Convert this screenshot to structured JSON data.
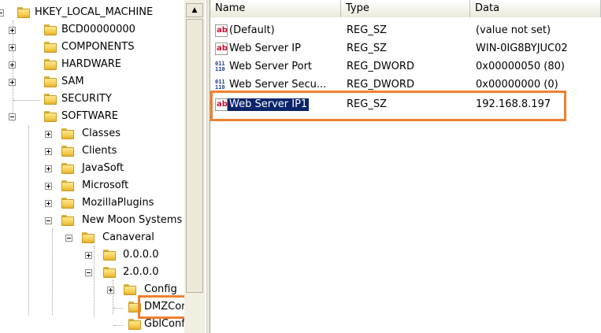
{
  "tree": {
    "root": "HKEY_LOCAL_MACHINE",
    "items": [
      {
        "label": "BCD00000000",
        "expandable": true
      },
      {
        "label": "COMPONENTS",
        "expandable": true
      },
      {
        "label": "HARDWARE",
        "expandable": true
      },
      {
        "label": "SAM",
        "expandable": true
      },
      {
        "label": "SECURITY",
        "expandable": false
      },
      {
        "label": "SOFTWARE",
        "expanded": true
      },
      {
        "label": "Classes"
      },
      {
        "label": "Clients"
      },
      {
        "label": "JavaSoft"
      },
      {
        "label": "Microsoft"
      },
      {
        "label": "MozillaPlugins"
      },
      {
        "label": "New Moon Systems",
        "expanded": true
      },
      {
        "label": "Canaveral",
        "expanded": true
      },
      {
        "label": "0.0.0.0"
      },
      {
        "label": "2.0.0.0",
        "expanded": true
      },
      {
        "label": "Config"
      },
      {
        "label": "DMZCon",
        "highlighted": true
      },
      {
        "label": "GblConfi"
      }
    ]
  },
  "list": {
    "columns": [
      "Name",
      "Type",
      "Data"
    ],
    "rows": [
      {
        "icon": "string-value-icon",
        "name": "(Default)",
        "type": "REG_SZ",
        "data": "(value not set)"
      },
      {
        "icon": "string-value-icon",
        "name": "Web Server IP",
        "type": "REG_SZ",
        "data": "WIN-0IG8BYJUC02"
      },
      {
        "icon": "binary-value-icon",
        "name": "Web Server Port",
        "type": "REG_DWORD",
        "data": "0x00000050 (80)"
      },
      {
        "icon": "binary-value-icon",
        "name": "Web Server Secu...",
        "type": "REG_DWORD",
        "data": "0x00000000 (0)"
      },
      {
        "icon": "string-value-icon",
        "name": "Web Server IP1",
        "type": "REG_SZ",
        "data": "192.168.8.197",
        "selected": true
      }
    ]
  },
  "colors": {
    "highlight": "#f08030",
    "selection": "#0a246a"
  }
}
